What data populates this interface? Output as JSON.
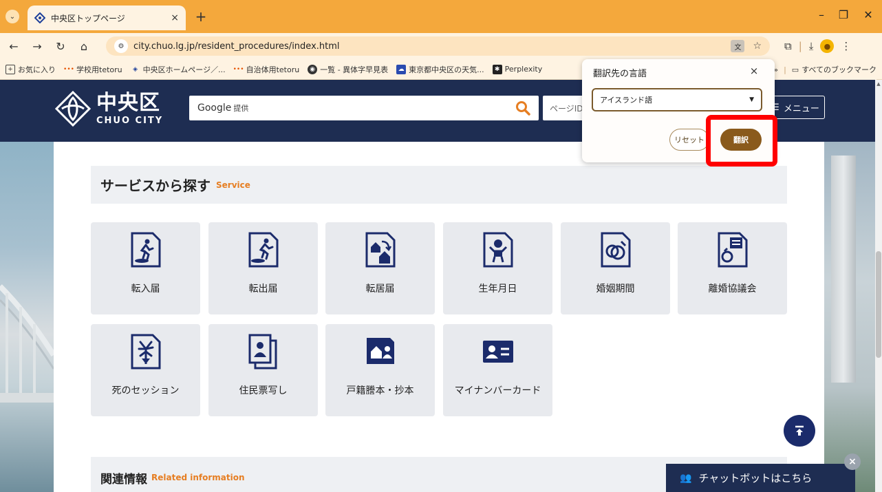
{
  "browser": {
    "tab_title": "中央区トップページ",
    "tab_close": "×",
    "new_tab": "+",
    "url": "city.chuo.lg.jp/resident_procedures/index.html",
    "window_controls": {
      "minimize": "–",
      "restore": "❐",
      "close": "✕"
    }
  },
  "bookmarks": {
    "items": [
      {
        "label": "お気に入り",
        "icon": "bookmark-folder-icon"
      },
      {
        "label": "学校用tetoru",
        "icon": "tetoru-icon"
      },
      {
        "label": "中央区ホームページ／...",
        "icon": "chuo-icon"
      },
      {
        "label": "自治体用tetoru",
        "icon": "tetoru-icon"
      },
      {
        "label": "一覧 - 異体字早見表",
        "icon": "globe-icon"
      },
      {
        "label": "東京都中央区の天気...",
        "icon": "weather-icon"
      },
      {
        "label": "Perplexity",
        "icon": "perplexity-icon"
      }
    ],
    "more": "»",
    "all_bookmarks": "すべてのブックマーク"
  },
  "site": {
    "logo_jp": "中央区",
    "logo_en": "CHUO CITY",
    "search_provider": "Google",
    "search_provided": "提供",
    "page_search_placeholder": "ページID",
    "menu_label": "メニュー"
  },
  "section": {
    "title": "サービスから探す",
    "subtitle": "Service"
  },
  "services": [
    {
      "label": "転入届",
      "icon": "moving-in-icon"
    },
    {
      "label": "転出届",
      "icon": "moving-out-icon"
    },
    {
      "label": "転居届",
      "icon": "relocation-icon"
    },
    {
      "label": "生年月日",
      "icon": "baby-icon"
    },
    {
      "label": "婚姻期間",
      "icon": "rings-icon"
    },
    {
      "label": "離婚協議会",
      "icon": "divorce-icon"
    },
    {
      "label": "死のセッション",
      "icon": "flower-icon"
    },
    {
      "label": "住民票写し",
      "icon": "resident-card-icon"
    },
    {
      "label": "戸籍謄本・抄本",
      "icon": "family-register-icon"
    },
    {
      "label": "マイナンバーカード",
      "icon": "mynumber-card-icon"
    }
  ],
  "related": {
    "title": "関連情報",
    "subtitle": "Related information"
  },
  "chatbot": {
    "label": "チャットボットはこちら",
    "close": "×"
  },
  "translate_popup": {
    "title": "翻訳先の言語",
    "close": "×",
    "selected_language": "アイスランド語",
    "reset_label": "リセット",
    "translate_label": "翻訳"
  },
  "colors": {
    "tabbar": "#f4a83c",
    "site_header": "#1e2d52",
    "accent_orange": "#e67e22",
    "translate_button": "#8a5a1c",
    "highlight": "#ff0000"
  }
}
